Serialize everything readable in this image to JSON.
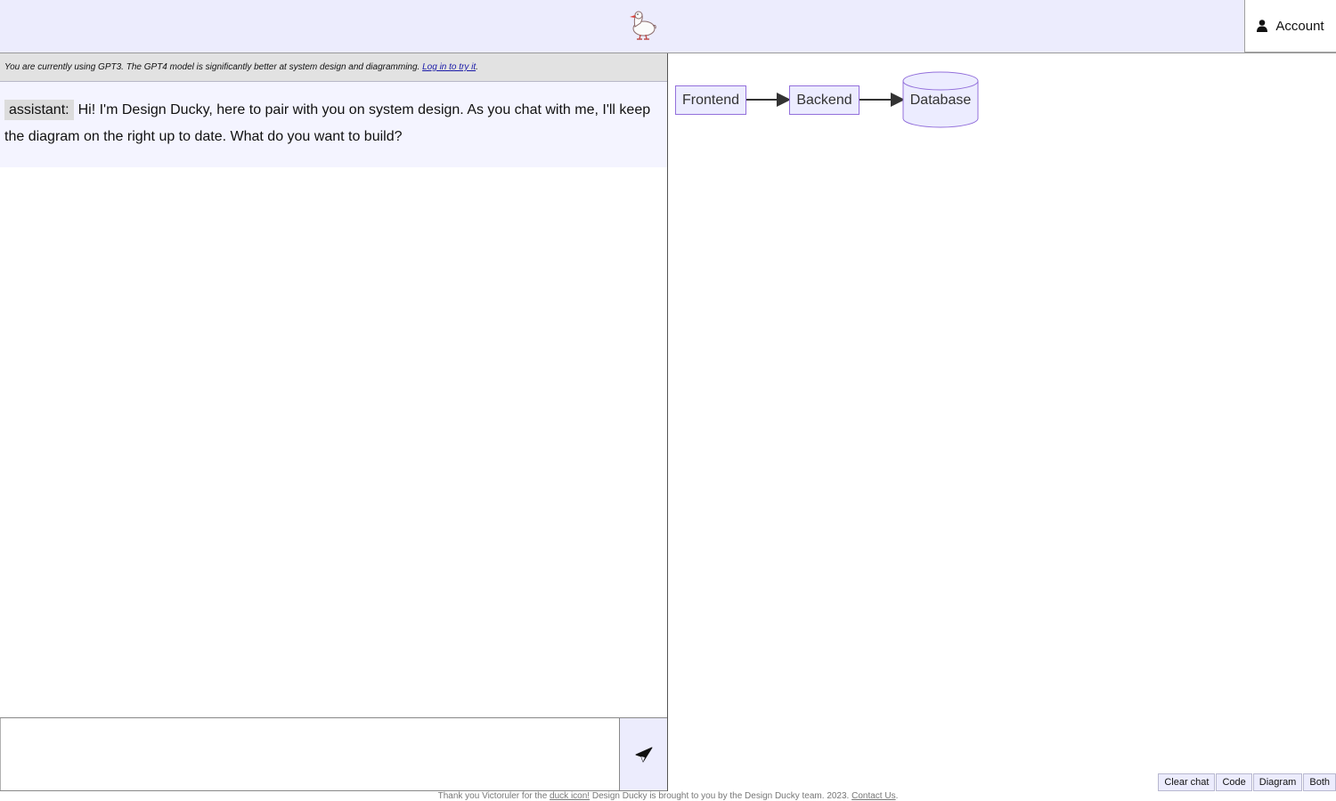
{
  "header": {
    "logo_icon": "duck-icon",
    "account_label": "Account",
    "account_icon": "user-icon"
  },
  "notice": {
    "text": "You are currently using GPT3. The GPT4 model is significantly better at system design and diagramming. ",
    "link_label": "Log in to try it",
    "suffix": "."
  },
  "chat": {
    "messages": [
      {
        "role": "assistant:",
        "text": "Hi! I'm Design Ducky, here to pair with you on system design. As you chat with me, I'll keep the diagram on the right up to date. What do you want to build?"
      }
    ],
    "input_value": "",
    "send_icon": "paper-plane-icon"
  },
  "diagram": {
    "nodes": [
      {
        "id": "frontend",
        "label": "Frontend",
        "shape": "rect"
      },
      {
        "id": "backend",
        "label": "Backend",
        "shape": "rect"
      },
      {
        "id": "database",
        "label": "Database",
        "shape": "cylinder"
      }
    ],
    "edges": [
      {
        "from": "frontend",
        "to": "backend"
      },
      {
        "from": "backend",
        "to": "database"
      }
    ],
    "colors": {
      "fill": "#ececff",
      "stroke": "#9370db",
      "edge": "#333333"
    }
  },
  "view_buttons": [
    "Clear chat",
    "Code",
    "Diagram",
    "Both"
  ],
  "footer": {
    "prefix": "Thank you Victoruler for the ",
    "duck_link": "duck icon!",
    "middle": " Design Ducky is brought to you by the Design Ducky team. 2023. ",
    "contact_link": "Contact Us",
    "suffix": "."
  }
}
